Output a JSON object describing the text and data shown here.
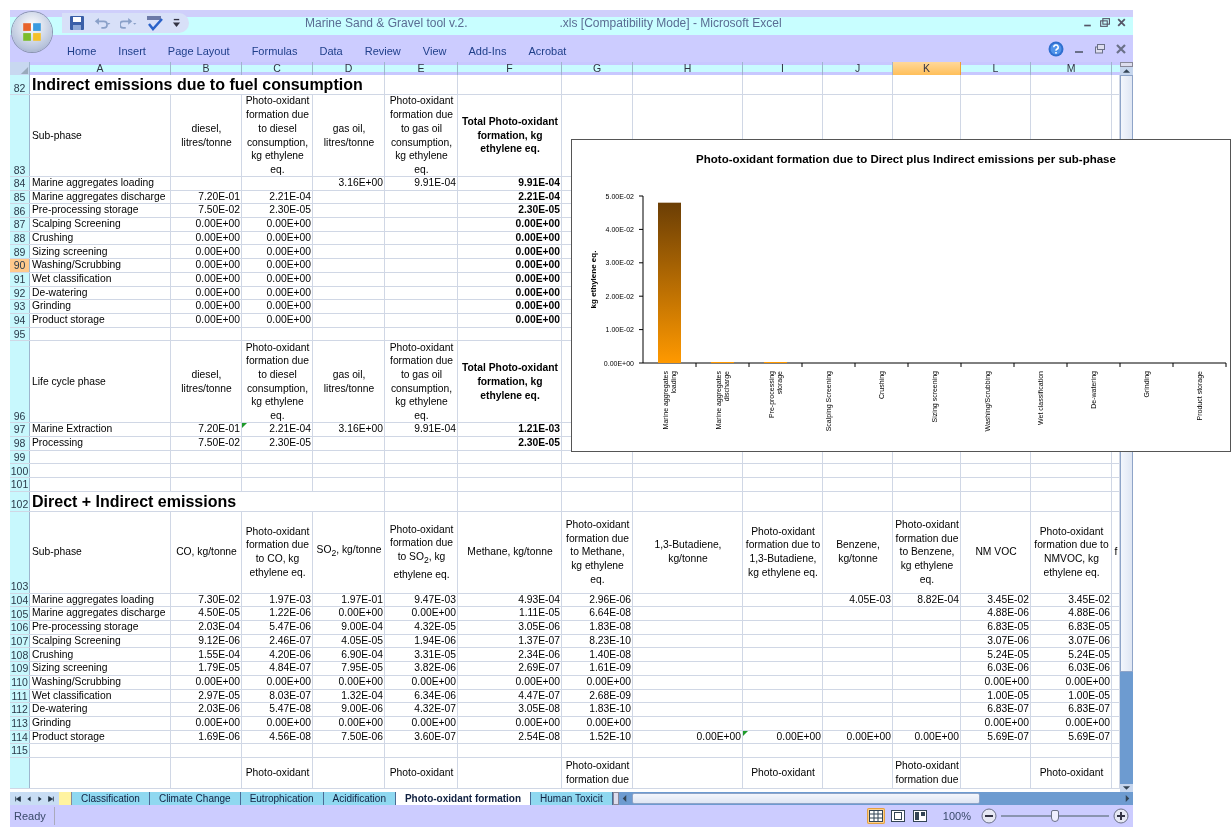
{
  "window": {
    "title": "Marine Sand & Gravel tool v.2.",
    "title_suffix": ".xls  [Compatibility Mode]  -  Microsoft Excel"
  },
  "ribbon_tabs": [
    "Home",
    "Insert",
    "Page Layout",
    "Formulas",
    "Data",
    "Review",
    "View",
    "Add-Ins",
    "Acrobat"
  ],
  "columns": [
    {
      "label": "A",
      "selected": false
    },
    {
      "label": "B",
      "selected": false
    },
    {
      "label": "C",
      "selected": false
    },
    {
      "label": "D",
      "selected": false
    },
    {
      "label": "E",
      "selected": false
    },
    {
      "label": "F",
      "selected": false
    },
    {
      "label": "G",
      "selected": false
    },
    {
      "label": "H",
      "selected": false
    },
    {
      "label": "I",
      "selected": false
    },
    {
      "label": "J",
      "selected": false
    },
    {
      "label": "K",
      "selected": true
    },
    {
      "label": "L",
      "selected": false
    },
    {
      "label": "M",
      "selected": false
    }
  ],
  "rows": [
    {
      "number": "82",
      "kind": "title",
      "selected": false,
      "cells": [
        "Indirect emissions due to fuel consumption"
      ]
    },
    {
      "number": "83",
      "kind": "header",
      "selected": false,
      "cells": [
        "Sub-phase",
        "diesel, litres/tonne",
        "Photo-oxidant formation due to diesel consumption, kg ethylene eq.",
        "gas oil, litres/tonne",
        "Photo-oxidant formation due to gas oil consumption, kg ethylene eq.",
        {
          "text": "Total Photo-oxidant formation, kg ethylene eq.",
          "bold": true
        }
      ]
    },
    {
      "number": "84",
      "kind": "data",
      "selected": false,
      "cells": [
        "Marine aggregates loading",
        null,
        null,
        "3.16E+00",
        "9.91E-04",
        {
          "text": "9.91E-04",
          "bold": true
        }
      ]
    },
    {
      "number": "85",
      "kind": "data",
      "selected": false,
      "cells": [
        "Marine aggregates discharge",
        "7.20E-01",
        "2.21E-04",
        null,
        null,
        {
          "text": "2.21E-04",
          "bold": true
        }
      ]
    },
    {
      "number": "86",
      "kind": "data",
      "selected": false,
      "cells": [
        "Pre-processing storage",
        "7.50E-02",
        "2.30E-05",
        null,
        null,
        {
          "text": "2.30E-05",
          "bold": true
        }
      ]
    },
    {
      "number": "87",
      "kind": "data",
      "selected": false,
      "cells": [
        "Scalping Screening",
        "0.00E+00",
        "0.00E+00",
        null,
        null,
        {
          "text": "0.00E+00",
          "bold": true
        }
      ]
    },
    {
      "number": "88",
      "kind": "data",
      "selected": false,
      "cells": [
        "Crushing",
        "0.00E+00",
        "0.00E+00",
        null,
        null,
        {
          "text": "0.00E+00",
          "bold": true
        }
      ]
    },
    {
      "number": "89",
      "kind": "data",
      "selected": false,
      "cells": [
        "Sizing screening",
        "0.00E+00",
        "0.00E+00",
        null,
        null,
        {
          "text": "0.00E+00",
          "bold": true
        }
      ]
    },
    {
      "number": "90",
      "kind": "data",
      "selected": true,
      "cells": [
        "Washing/Scrubbing",
        "0.00E+00",
        "0.00E+00",
        null,
        null,
        {
          "text": "0.00E+00",
          "bold": true
        }
      ]
    },
    {
      "number": "91",
      "kind": "data",
      "selected": false,
      "cells": [
        "Wet classification",
        "0.00E+00",
        "0.00E+00",
        null,
        null,
        {
          "text": "0.00E+00",
          "bold": true
        }
      ]
    },
    {
      "number": "92",
      "kind": "data",
      "selected": false,
      "cells": [
        "De-watering",
        "0.00E+00",
        "0.00E+00",
        null,
        null,
        {
          "text": "0.00E+00",
          "bold": true
        }
      ]
    },
    {
      "number": "93",
      "kind": "data",
      "selected": false,
      "cells": [
        "Grinding",
        "0.00E+00",
        "0.00E+00",
        null,
        null,
        {
          "text": "0.00E+00",
          "bold": true
        }
      ]
    },
    {
      "number": "94",
      "kind": "data",
      "selected": false,
      "cells": [
        "Product storage",
        "0.00E+00",
        "0.00E+00",
        null,
        null,
        {
          "text": "0.00E+00",
          "bold": true
        }
      ]
    },
    {
      "number": "95",
      "kind": "blank",
      "selected": false,
      "cells": []
    },
    {
      "number": "96",
      "kind": "header",
      "selected": false,
      "cells": [
        "Life cycle phase",
        "diesel, litres/tonne",
        "Photo-oxidant formation due to diesel consumption, kg ethylene eq.",
        "gas oil, litres/tonne",
        "Photo-oxidant formation due to gas oil consumption, kg ethylene eq.",
        {
          "text": "Total Photo-oxidant formation, kg ethylene eq.",
          "bold": true
        }
      ]
    },
    {
      "number": "97",
      "kind": "data",
      "selected": false,
      "cells": [
        "Marine Extraction",
        "7.20E-01",
        {
          "text": "2.21E-04",
          "error_flag": true
        },
        "3.16E+00",
        "9.91E-04",
        {
          "text": "1.21E-03",
          "bold": true
        }
      ]
    },
    {
      "number": "98",
      "kind": "data",
      "selected": false,
      "cells": [
        "Processing",
        "7.50E-02",
        "2.30E-05",
        null,
        null,
        {
          "text": "2.30E-05",
          "bold": true
        }
      ]
    },
    {
      "number": "99",
      "kind": "blank",
      "selected": false,
      "cells": []
    },
    {
      "number": "100",
      "kind": "blank",
      "selected": false,
      "cells": []
    },
    {
      "number": "101",
      "kind": "blank",
      "selected": false,
      "cells": []
    },
    {
      "number": "102",
      "kind": "title",
      "selected": false,
      "cells": [
        "Direct + Indirect emissions"
      ]
    },
    {
      "number": "103",
      "kind": "header",
      "selected": false,
      "cells": [
        "Sub-phase",
        "CO, kg/tonne",
        "Photo-oxidant formation due to CO, kg ethylene eq.",
        "SO$_{2}$, kg/tonne",
        "Photo-oxidant formation due to SO$_{2}$, kg ethylene eq.",
        "Methane, kg/tonne",
        "Photo-oxidant formation due to Methane, kg ethylene eq.",
        "1,3-Butadiene, kg/tonne",
        "Photo-oxidant formation due to 1,3-Butadiene, kg ethylene eq.",
        "Benzene, kg/tonne",
        "Photo-oxidant formation due to Benzene, kg ethylene eq.",
        "NM VOC",
        "Photo-oxidant formation due to NMVOC, kg ethylene eq.",
        "f"
      ]
    },
    {
      "number": "104",
      "kind": "data",
      "selected": false,
      "cells": [
        "Marine aggregates loading",
        "7.30E-02",
        "1.97E-03",
        "1.97E-01",
        "9.47E-03",
        "4.93E-04",
        "2.96E-06",
        null,
        null,
        "4.05E-03",
        "8.82E-04",
        "3.45E-02",
        "3.45E-02"
      ]
    },
    {
      "number": "105",
      "kind": "data",
      "selected": false,
      "cells": [
        "Marine aggregates discharge",
        "4.50E-05",
        "1.22E-06",
        "0.00E+00",
        "0.00E+00",
        "1.11E-05",
        "6.64E-08",
        null,
        null,
        null,
        null,
        "4.88E-06",
        "4.88E-06"
      ]
    },
    {
      "number": "106",
      "kind": "data",
      "selected": false,
      "cells": [
        "Pre-processing storage",
        "2.03E-04",
        "5.47E-06",
        "9.00E-04",
        "4.32E-05",
        "3.05E-06",
        "1.83E-08",
        null,
        null,
        null,
        null,
        "6.83E-05",
        "6.83E-05"
      ]
    },
    {
      "number": "107",
      "kind": "data",
      "selected": false,
      "cells": [
        "Scalping Screening",
        "9.12E-06",
        "2.46E-07",
        "4.05E-05",
        "1.94E-06",
        "1.37E-07",
        "8.23E-10",
        null,
        null,
        null,
        null,
        "3.07E-06",
        "3.07E-06"
      ]
    },
    {
      "number": "108",
      "kind": "data",
      "selected": false,
      "cells": [
        "Crushing",
        "1.55E-04",
        "4.20E-06",
        "6.90E-04",
        "3.31E-05",
        "2.34E-06",
        "1.40E-08",
        null,
        null,
        null,
        null,
        "5.24E-05",
        "5.24E-05"
      ]
    },
    {
      "number": "109",
      "kind": "data",
      "selected": false,
      "cells": [
        "Sizing screening",
        "1.79E-05",
        "4.84E-07",
        "7.95E-05",
        "3.82E-06",
        "2.69E-07",
        "1.61E-09",
        null,
        null,
        null,
        null,
        "6.03E-06",
        "6.03E-06"
      ]
    },
    {
      "number": "110",
      "kind": "data",
      "selected": false,
      "cells": [
        "Washing/Scrubbing",
        "0.00E+00",
        "0.00E+00",
        "0.00E+00",
        "0.00E+00",
        "0.00E+00",
        "0.00E+00",
        null,
        null,
        null,
        null,
        "0.00E+00",
        "0.00E+00"
      ]
    },
    {
      "number": "111",
      "kind": "data",
      "selected": false,
      "cells": [
        "Wet classification",
        "2.97E-05",
        "8.03E-07",
        "1.32E-04",
        "6.34E-06",
        "4.47E-07",
        "2.68E-09",
        null,
        null,
        null,
        null,
        "1.00E-05",
        "1.00E-05"
      ]
    },
    {
      "number": "112",
      "kind": "data",
      "selected": false,
      "cells": [
        "De-watering",
        "2.03E-06",
        "5.47E-08",
        "9.00E-06",
        "4.32E-07",
        "3.05E-08",
        "1.83E-10",
        null,
        null,
        null,
        null,
        "6.83E-07",
        "6.83E-07"
      ]
    },
    {
      "number": "113",
      "kind": "data",
      "selected": false,
      "cells": [
        "Grinding",
        "0.00E+00",
        "0.00E+00",
        "0.00E+00",
        "0.00E+00",
        "0.00E+00",
        "0.00E+00",
        null,
        null,
        null,
        null,
        "0.00E+00",
        "0.00E+00"
      ]
    },
    {
      "number": "114",
      "kind": "data",
      "selected": false,
      "cells": [
        "Product storage",
        "1.69E-06",
        "4.56E-08",
        "7.50E-06",
        "3.60E-07",
        "2.54E-08",
        "1.52E-10",
        "0.00E+00",
        {
          "text": "0.00E+00",
          "error_flag": true
        },
        "0.00E+00",
        "0.00E+00",
        "5.69E-07",
        "5.69E-07"
      ]
    },
    {
      "number": "115",
      "kind": "blank",
      "selected": false,
      "cells": []
    },
    {
      "kind": "partial",
      "selected": false,
      "cells": [
        null,
        null,
        "Photo-oxidant",
        null,
        "Photo-oxidant",
        null,
        "Photo-oxidant formation due",
        null,
        "Photo-oxidant",
        null,
        "Photo-oxidant formation due",
        null,
        "Photo-oxidant"
      ]
    }
  ],
  "chart": {
    "chart_data": {
      "type": "bar",
      "title": "Photo-oxidant formation due to Direct plus Indirect emissions per sub-phase",
      "ylabel": "kg ethylene eq.",
      "categories": [
        "Marine aggregates loading",
        "Marine aggregates discharge",
        "Pre-processing storage",
        "Scalping Screening",
        "Crushing",
        "Sizing screening",
        "Washing/Scrubbing",
        "Wet classification",
        "De-watering",
        "Grinding",
        "Product storage"
      ],
      "series": [
        {
          "color": "#ff9900",
          "values": [
            0.048,
            0.0003,
            0.0003,
            0,
            0,
            0,
            0,
            0,
            0,
            0,
            0
          ]
        }
      ],
      "ylim": [
        0,
        0.05
      ],
      "yticks": [
        {
          "value": 0,
          "label": "0.00E+00"
        },
        {
          "value": 0.01,
          "label": "1.00E-02"
        },
        {
          "value": 0.02,
          "label": "2.00E-02"
        },
        {
          "value": 0.03,
          "label": "3.00E-02"
        },
        {
          "value": 0.04,
          "label": "4.00E-02"
        },
        {
          "value": 0.05,
          "label": "5.00E-02"
        }
      ]
    }
  },
  "sheet_tabs": [
    {
      "label": "Classification",
      "selected": false
    },
    {
      "label": "Climate Change",
      "selected": false
    },
    {
      "label": "Eutrophication",
      "selected": false
    },
    {
      "label": "Acidification",
      "selected": false
    },
    {
      "label": "Photo-oxidant formation",
      "selected": true
    },
    {
      "label": "Human Toxicit",
      "selected": false
    }
  ],
  "status_bar": {
    "status": "Ready",
    "views": [
      {
        "kind": "normal",
        "selected": true
      },
      {
        "kind": "page_layout",
        "selected": false
      },
      {
        "kind": "page_break",
        "selected": false
      }
    ],
    "zoom": "100%",
    "zoom_slider": {
      "level": 0.5
    }
  }
}
